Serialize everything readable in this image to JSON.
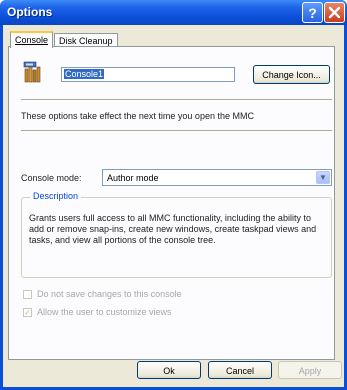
{
  "window": {
    "title": "Options"
  },
  "tabs": [
    {
      "label": "Console",
      "active": true
    },
    {
      "label": "Disk Cleanup",
      "active": false
    }
  ],
  "console": {
    "icon": "mmc-console-icon",
    "name_value": "Console1",
    "change_icon_label": "Change Icon..."
  },
  "info_text": "These options take effect the next time you open the MMC",
  "console_mode": {
    "label": "Console mode:",
    "selected": "Author mode"
  },
  "description": {
    "label": "Description",
    "text": "Grants users full access to all MMC functionality, including the ability to add or remove snap-ins, create new windows, create taskpad views and tasks, and view all portions of the console tree."
  },
  "options": [
    {
      "label": "Do not save changes to this console",
      "checked": false,
      "enabled": false
    },
    {
      "label": "Allow the user to customize views",
      "checked": true,
      "enabled": false
    }
  ],
  "buttons": {
    "ok": "Ok",
    "cancel": "Cancel",
    "apply": "Apply"
  },
  "colors": {
    "titlebar": "#0a4fd8",
    "dialog_bg": "#ece9d8",
    "selection": "#316ac5",
    "group_label": "#0046d5"
  }
}
